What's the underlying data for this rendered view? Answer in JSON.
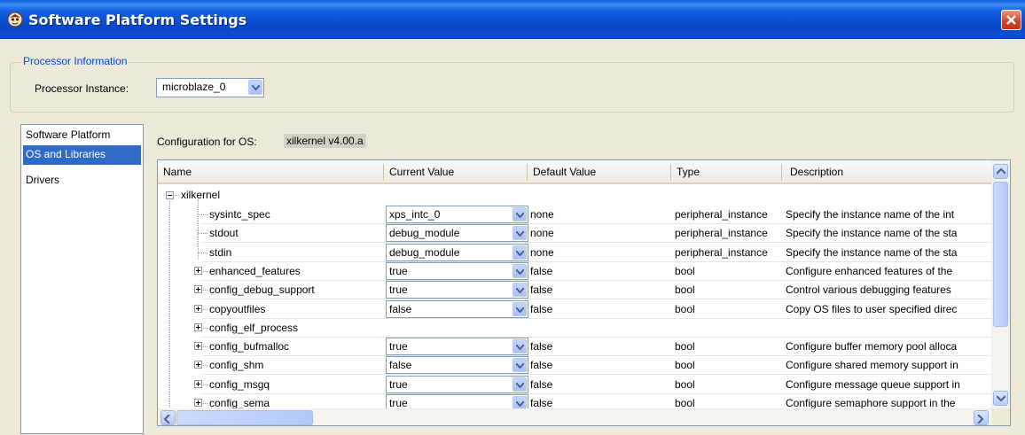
{
  "window": {
    "title": "Software Platform Settings"
  },
  "processor": {
    "group_title": "Processor Information",
    "instance_label": "Processor Instance:",
    "instance_value": "microblaze_0"
  },
  "nav": {
    "items": [
      {
        "label": "Software Platform",
        "selected": false
      },
      {
        "label": "OS and Libraries",
        "selected": true
      },
      {
        "label": "Drivers",
        "selected": false
      }
    ]
  },
  "config": {
    "label": "Configuration for OS:",
    "value": "xilkernel v4.00.a"
  },
  "table": {
    "columns": [
      "Name",
      "Current Value",
      "Default Value",
      "Type",
      "Description"
    ],
    "root": "xilkernel",
    "rows": [
      {
        "name": "sysintc_spec",
        "current": "xps_intc_0",
        "default": "none",
        "type": "peripheral_instance",
        "desc": "Specify the instance name of the int",
        "expander": "none"
      },
      {
        "name": "stdout",
        "current": "debug_module",
        "default": "none",
        "type": "peripheral_instance",
        "desc": "Specify the instance name of the sta",
        "expander": "none"
      },
      {
        "name": "stdin",
        "current": "debug_module",
        "default": "none",
        "type": "peripheral_instance",
        "desc": "Specify the instance name of the sta",
        "expander": "none"
      },
      {
        "name": "enhanced_features",
        "current": "true",
        "default": "false",
        "type": "bool",
        "desc": "Configure enhanced features of the",
        "expander": "plus"
      },
      {
        "name": "config_debug_support",
        "current": "true",
        "default": "false",
        "type": "bool",
        "desc": "Control various debugging features",
        "expander": "plus"
      },
      {
        "name": "copyoutfiles",
        "current": "false",
        "default": "false",
        "type": "bool",
        "desc": "Copy OS files to user specified direc",
        "expander": "plus"
      },
      {
        "name": "config_elf_process",
        "current": "",
        "default": "",
        "type": "",
        "desc": "",
        "expander": "plus"
      },
      {
        "name": "config_bufmalloc",
        "current": "true",
        "default": "false",
        "type": "bool",
        "desc": "Configure buffer memory pool alloca",
        "expander": "plus"
      },
      {
        "name": "config_shm",
        "current": "false",
        "default": "false",
        "type": "bool",
        "desc": "Configure shared memory support in",
        "expander": "plus"
      },
      {
        "name": "config_msgq",
        "current": "true",
        "default": "false",
        "type": "bool",
        "desc": "Configure message queue support in",
        "expander": "plus"
      },
      {
        "name": "config_sema",
        "current": "true",
        "default": "false",
        "type": "bool",
        "desc": "Configure semaphore support in the",
        "expander": "plus"
      }
    ]
  },
  "colors": {
    "titlebar": "#0a4fd0",
    "selection": "#316ac5",
    "accent_text": "#0046d5"
  },
  "icons": {
    "app": "xilinx-platform-icon",
    "close": "close-icon",
    "dropdown": "chevron-down-icon"
  }
}
